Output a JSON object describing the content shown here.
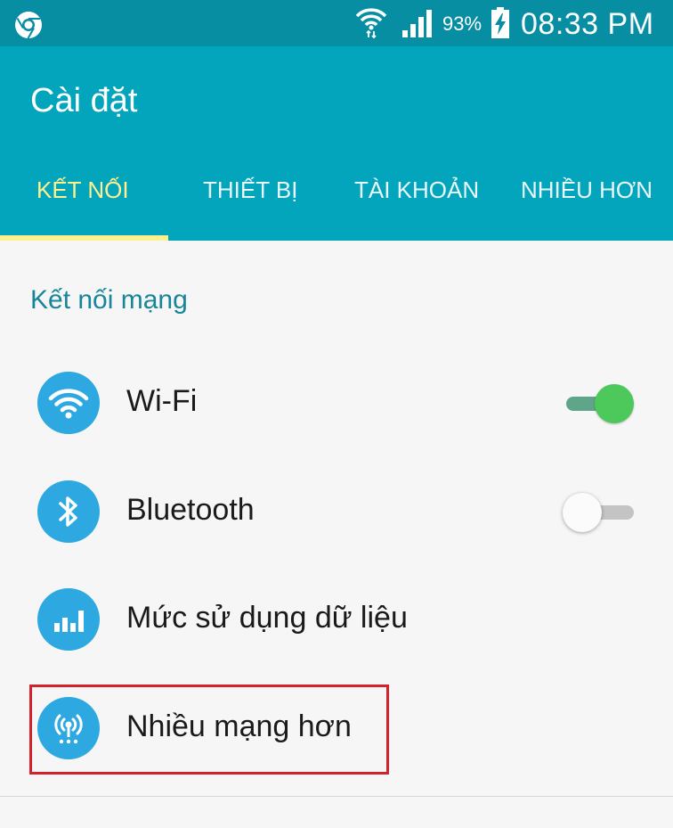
{
  "status_bar": {
    "left_icon": "chrome-icon",
    "wifi_icon": "wifi-icon",
    "signal_icon": "cell-signal-icon",
    "battery_percent": "93%",
    "battery_icon": "battery-charging-icon",
    "time": "08:33 PM"
  },
  "app_bar": {
    "title": "Cài đặt",
    "tabs": [
      {
        "label": "KẾT NỐI",
        "active": true
      },
      {
        "label": "THIẾT BỊ",
        "active": false
      },
      {
        "label": "TÀI KHOẢN",
        "active": false
      },
      {
        "label": "NHIỀU HƠN",
        "active": false
      }
    ]
  },
  "content": {
    "section_header": "Kết nối mạng",
    "items": [
      {
        "label": "Wi-Fi",
        "icon": "wifi-icon",
        "toggle": "on"
      },
      {
        "label": "Bluetooth",
        "icon": "bluetooth-icon",
        "toggle": "off"
      },
      {
        "label": "Mức sử dụng dữ liệu",
        "icon": "data-usage-icon"
      },
      {
        "label": "Nhiều mạng hơn",
        "icon": "more-networks-icon",
        "highlighted": true
      }
    ]
  },
  "colors": {
    "status_bar_bg": "#078ea3",
    "app_bar_bg": "#03a5bd",
    "active_tab": "#fdf08d",
    "section_header": "#17859a",
    "icon_circle": "#2da8e0",
    "toggle_on": "#4dc85a",
    "highlight_border": "#d3222c"
  }
}
